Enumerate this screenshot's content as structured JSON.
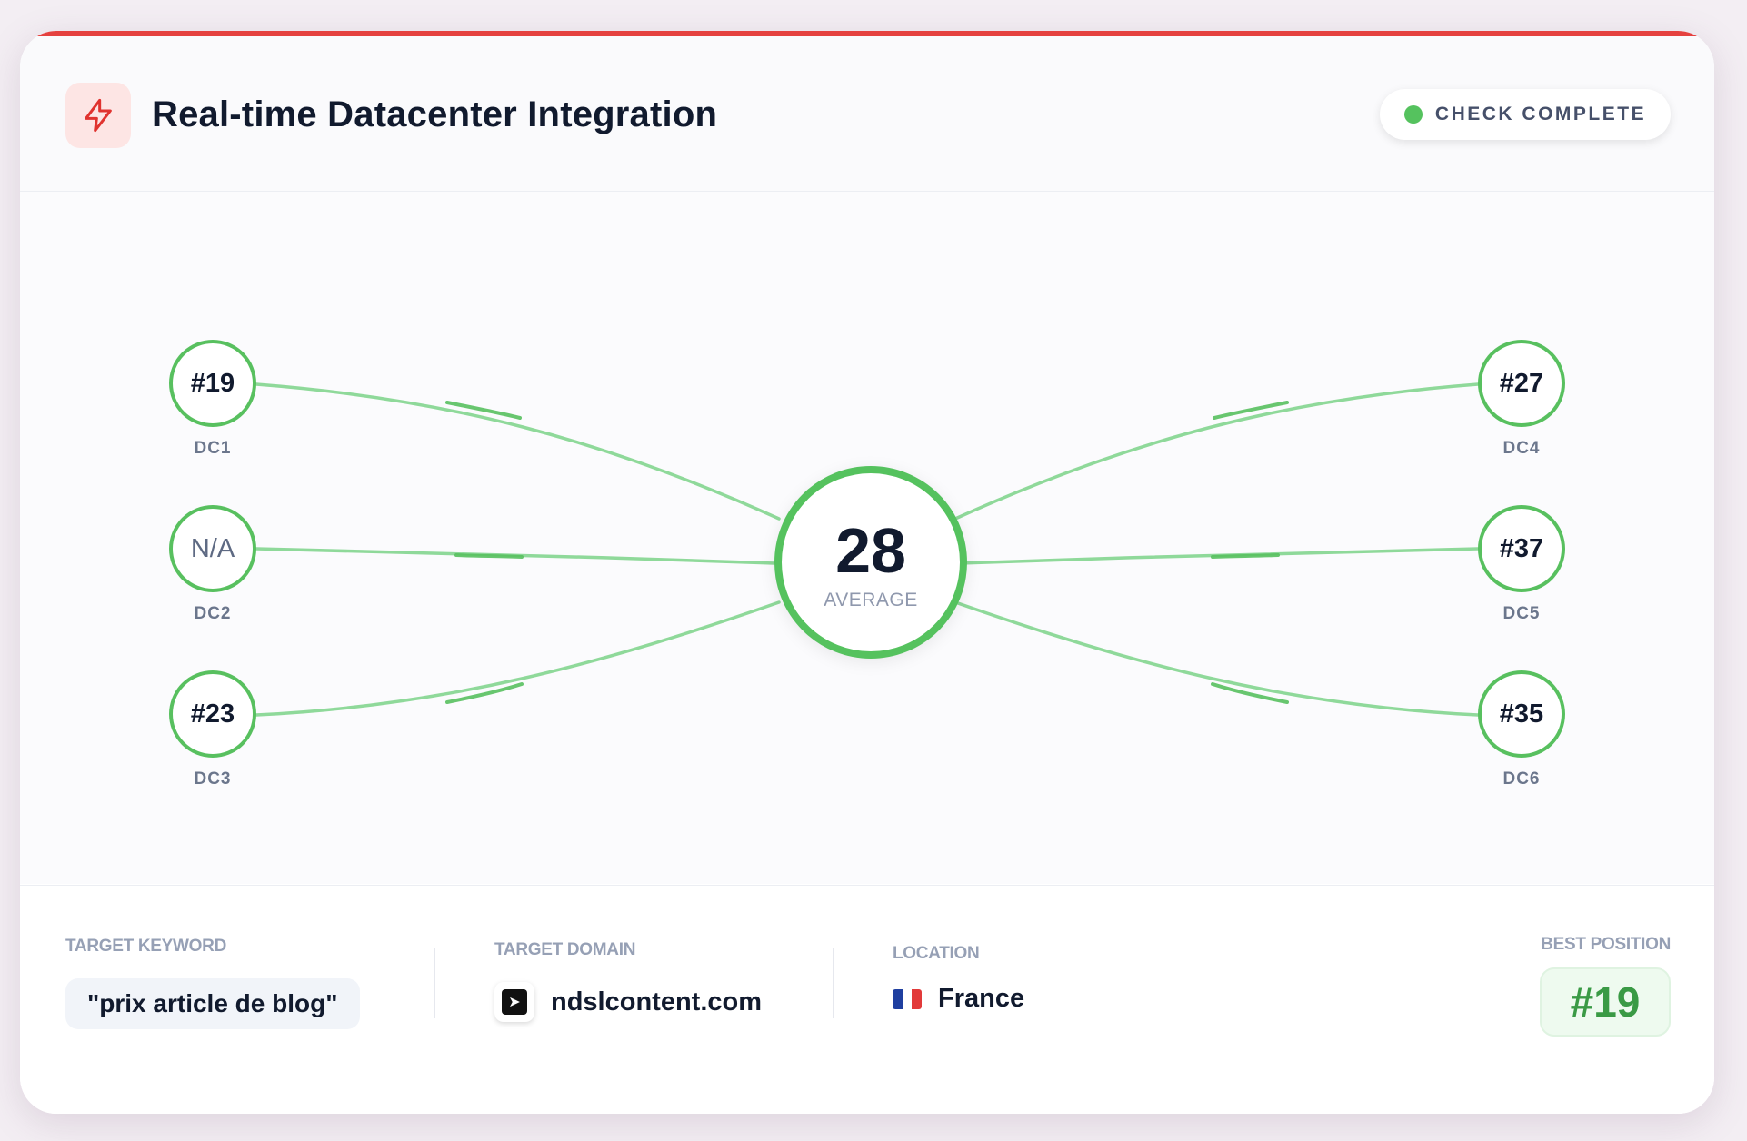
{
  "header": {
    "title": "Real-time Datacenter Integration",
    "logo_icon": "lightning-bolt-icon",
    "status": {
      "label": "CHECK COMPLETE",
      "color": "#55c25e"
    }
  },
  "center": {
    "value": "28",
    "label": "AVERAGE"
  },
  "datacenters": [
    {
      "name": "DC1",
      "rank": "#19"
    },
    {
      "name": "DC2",
      "rank": "N/A"
    },
    {
      "name": "DC3",
      "rank": "#23"
    },
    {
      "name": "DC4",
      "rank": "#27"
    },
    {
      "name": "DC5",
      "rank": "#37"
    },
    {
      "name": "DC6",
      "rank": "#35"
    }
  ],
  "footer": {
    "keyword": {
      "label": "TARGET KEYWORD",
      "value": "\"prix article de blog\""
    },
    "domain": {
      "label": "TARGET DOMAIN",
      "value": "ndslcontent.com"
    },
    "location": {
      "label": "LOCATION",
      "value": "France",
      "flag": "flag-france-icon"
    },
    "best": {
      "label": "BEST POSITION",
      "value": "#19"
    }
  },
  "colors": {
    "accent": "#e5413f",
    "success": "#55c25e",
    "connector": "#8fd99a",
    "title": "#111a2e"
  }
}
